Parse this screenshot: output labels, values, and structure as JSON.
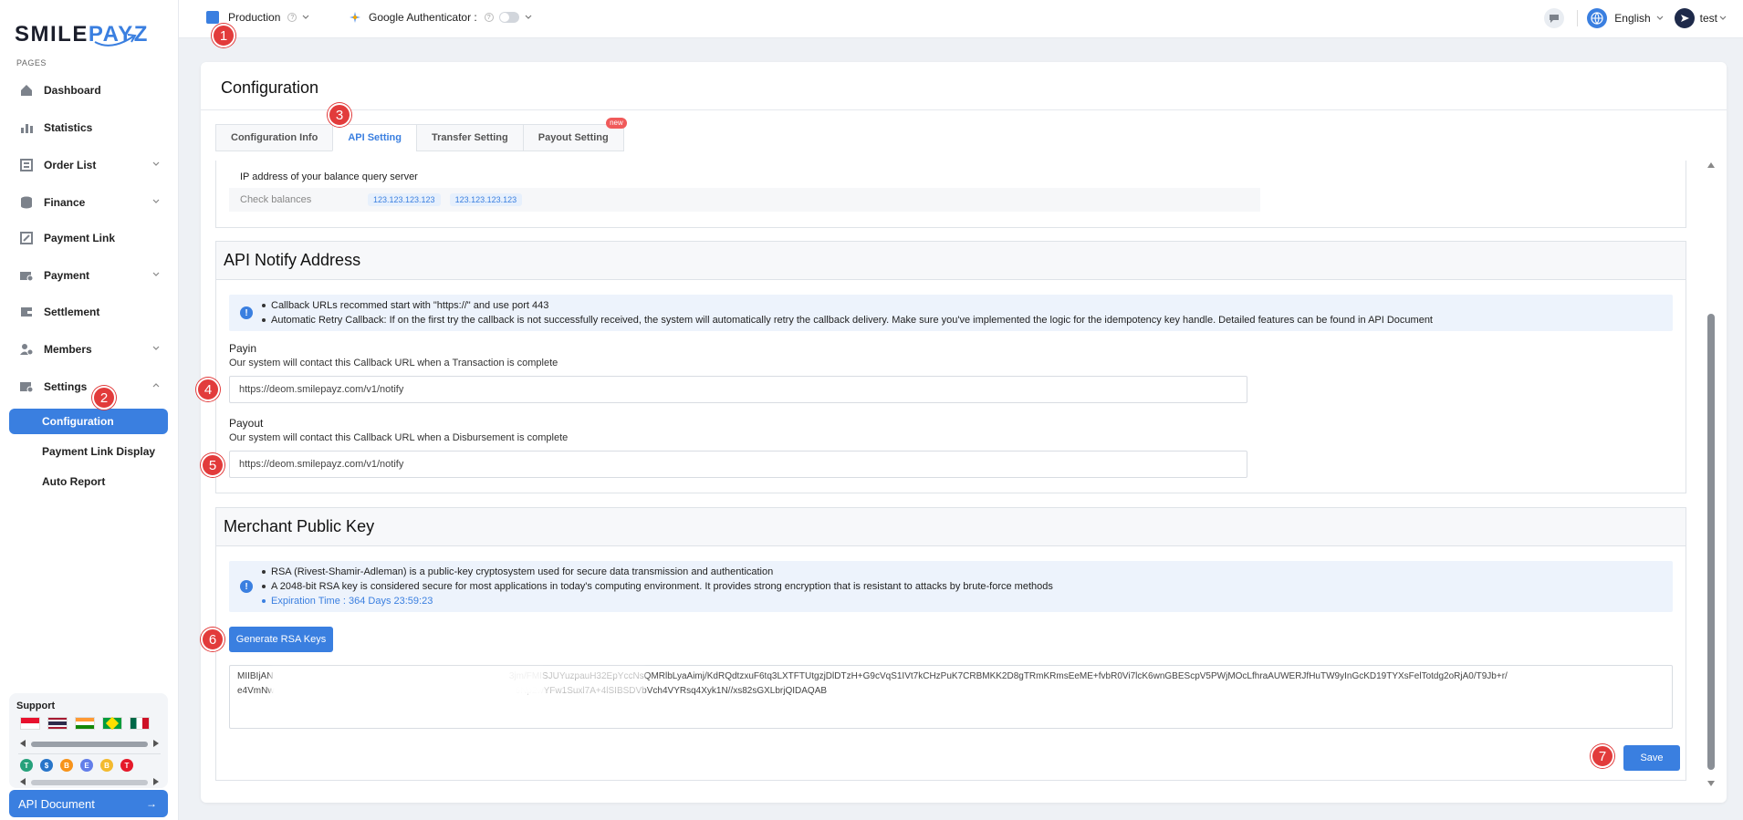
{
  "brand": {
    "logo_part1": "SMILE",
    "logo_part2": "PAYZ"
  },
  "sidebar": {
    "section_label": "PAGES",
    "items": [
      {
        "label": "Dashboard",
        "icon": "home-icon"
      },
      {
        "label": "Statistics",
        "icon": "bar-chart-icon"
      },
      {
        "label": "Order List",
        "icon": "list-icon"
      },
      {
        "label": "Finance",
        "icon": "database-icon"
      },
      {
        "label": "Payment Link",
        "icon": "link-icon"
      },
      {
        "label": "Payment",
        "icon": "payment-icon"
      },
      {
        "label": "Settlement",
        "icon": "wallet-icon"
      },
      {
        "label": "Members",
        "icon": "users-icon"
      },
      {
        "label": "Settings",
        "icon": "settings-icon"
      }
    ],
    "settings_sub": [
      "Configuration",
      "Payment Link Display",
      "Auto Report"
    ],
    "support_title": "Support",
    "api_doc_label": "API Document",
    "api_doc_arrow": "→"
  },
  "header": {
    "environment": "Production",
    "authenticator": "Google Authenticator :",
    "language": "English",
    "user": "test"
  },
  "page": {
    "title": "Configuration",
    "tabs": [
      "Configuration Info",
      "API Setting",
      "Transfer Setting",
      "Payout Setting"
    ],
    "active_tab": "API Setting",
    "tab_badge": "new"
  },
  "ip_section": {
    "title": "IP address of your balance query server",
    "check_label": "Check balances",
    "ips": [
      "123.123.123.123",
      "123.123.123.123"
    ]
  },
  "notify": {
    "title": "API Notify Address",
    "info": [
      "Callback URLs recommed start with \"https://\" and use port 443",
      "Automatic Retry Callback: If on the first try the callback is not successfully received, the system will automatically retry the callback delivery. Make sure you've implemented the logic for the idempotency key handle. Detailed features can be found in API Document"
    ],
    "payin_label": "Payin",
    "payin_desc": "Our system will contact this Callback URL when a Transaction is complete",
    "payin_value": "https://deom.smilepayz.com/v1/notify",
    "payout_label": "Payout",
    "payout_desc": "Our system will contact this Callback URL when a Disbursement is complete",
    "payout_value": "https://deom.smilepayz.com/v1/notify"
  },
  "public_key": {
    "title": "Merchant Public Key",
    "info": [
      "RSA (Rivest-Shamir-Adleman) is a public-key cryptosystem used for secure data transmission and authentication",
      "A 2048-bit RSA key is considered secure for most applications in today's computing environment. It provides strong encryption that is resistant to attacks by brute-force methods",
      "Expiration Time : 364 Days 23:59:23"
    ],
    "generate_label": "Generate RSA Keys",
    "key_value": "MIIBIjAN                                                                                             3jm/FMISJUYuzpauH32EpYccNsQMRlbLyaAimj/KdRQdtzxuF6tq3LXTFTUtgzjDlDTzH+G9cVqS1IVt7kCHzPuK7CRBMKK2D8gTRmKRmsEeME+fvbR0Vi7lcK6wnGBEScpV5PWjMOcLfhraAUWERJfHuTW9yInGcKD19TYXsFelTotdg2oRjA0/T9Jb+r/\ne4VmNw                                                                                               6Np2wYFw1Suxl7A+4lSIBSDVbVch4VYRsq4Xyk1N//xs82sGXLbrjQIDAQAB",
    "save_label": "Save"
  },
  "markers": [
    "1",
    "2",
    "3",
    "4",
    "5",
    "6",
    "7"
  ],
  "colors": {
    "accent": "#3a7fe0",
    "marker": "#e23b3b"
  }
}
